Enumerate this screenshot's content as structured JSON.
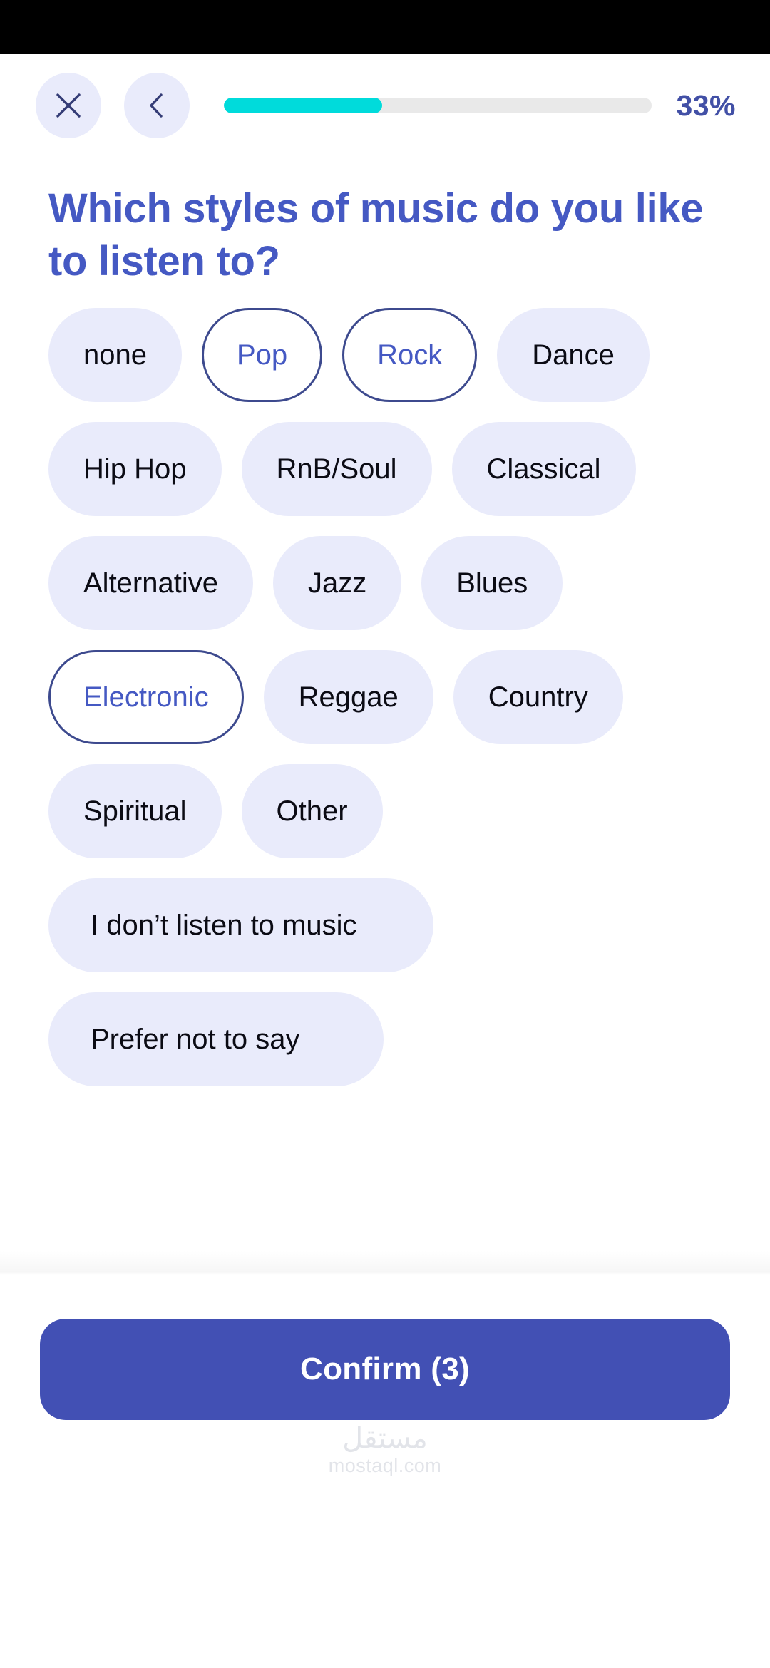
{
  "header": {
    "close_icon": "close-icon",
    "back_icon": "chevron-left-icon",
    "progress_percent_label": "33%",
    "progress_percent_value": 33,
    "progress_fill_ratio": 37,
    "progress_fill_color": "#00DBDB",
    "progress_track_color": "#E9E9E9",
    "percent_text_color": "#4250A6"
  },
  "question": {
    "title": "Which styles of music do you like to listen to?",
    "title_color": "#4559C3"
  },
  "options": [
    {
      "label": "none",
      "selected": false,
      "width": "auto"
    },
    {
      "label": "Pop",
      "selected": true,
      "width": "auto"
    },
    {
      "label": "Rock",
      "selected": true,
      "width": "auto"
    },
    {
      "label": "Dance",
      "selected": false,
      "width": "auto"
    },
    {
      "label": "Hip Hop",
      "selected": false,
      "width": "auto"
    },
    {
      "label": "RnB/Soul",
      "selected": false,
      "width": "auto"
    },
    {
      "label": "Classical",
      "selected": false,
      "width": "auto"
    },
    {
      "label": "Alternative",
      "selected": false,
      "width": "auto"
    },
    {
      "label": "Jazz",
      "selected": false,
      "width": "auto"
    },
    {
      "label": "Blues",
      "selected": false,
      "width": "auto"
    },
    {
      "label": "Electronic",
      "selected": true,
      "width": "auto"
    },
    {
      "label": "Reggae",
      "selected": false,
      "width": "auto"
    },
    {
      "label": "Country",
      "selected": false,
      "width": "auto"
    },
    {
      "label": "Spiritual",
      "selected": false,
      "width": "auto"
    },
    {
      "label": "Other",
      "selected": false,
      "width": "auto"
    },
    {
      "label": "I don’t listen to music",
      "selected": false,
      "width": "wide-dontlisten"
    },
    {
      "label": "Prefer not to say",
      "selected": false,
      "width": "wide-prefer"
    }
  ],
  "footer": {
    "confirm_label": "Confirm (3)",
    "confirm_count": 3,
    "confirm_color": "#4250B4"
  },
  "watermark": {
    "arabic": "مستقل",
    "domain": "mostaql.com"
  },
  "colors": {
    "chip_unselected_bg": "#E9EBFB",
    "chip_selected_border": "#3D4A8E",
    "chip_selected_text": "#4559C3",
    "accent_cyan": "#00DBDB",
    "brand_blue": "#4250B4",
    "status_bar": "#000000"
  }
}
